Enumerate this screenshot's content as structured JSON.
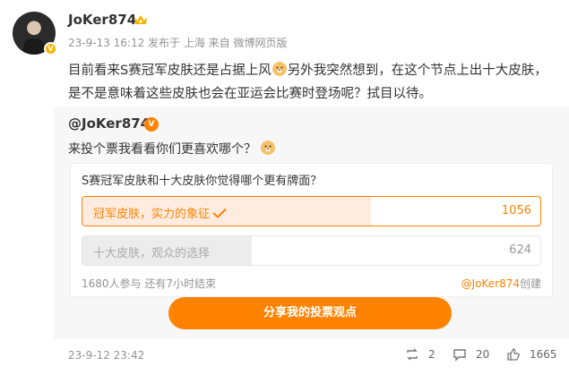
{
  "post": {
    "username": "JoKer874",
    "meta": "23-9-13 16:12 发布于 上海 来自 微博网页版",
    "text_part1": "目前看来S赛冠军皮肤还是占据上风",
    "text_part2": "另外我突然想到，在这个节点上出十大皮肤，是不是意味着这些皮肤也会在亚运会比赛时登场呢？拭目以待。",
    "badge_v": "V"
  },
  "repost": {
    "user": "@JoKer874",
    "text": "来投个票我看看你们更喜欢哪个？",
    "vote_badge": "V"
  },
  "poll": {
    "question": "S赛冠军皮肤和十大皮肤你觉得哪个更有牌面？",
    "options": [
      {
        "label": "冠军皮肤，实力的象征",
        "count": "1056",
        "share": 0.63,
        "selected": true
      },
      {
        "label": "十大皮肤，观众的选择",
        "count": "624",
        "share": 0.37,
        "selected": false
      }
    ],
    "stats": "1680人参与 还有7小时结束",
    "creator_link": "@JoKer874",
    "creator_suffix": "创建",
    "share_label": "分享我的投票观点"
  },
  "footer": {
    "time": "23-9-12 23:42",
    "reposts": "2",
    "comments": "20",
    "likes": "1665"
  },
  "colors": {
    "accent": "#ff8200",
    "muted": "#939393"
  }
}
